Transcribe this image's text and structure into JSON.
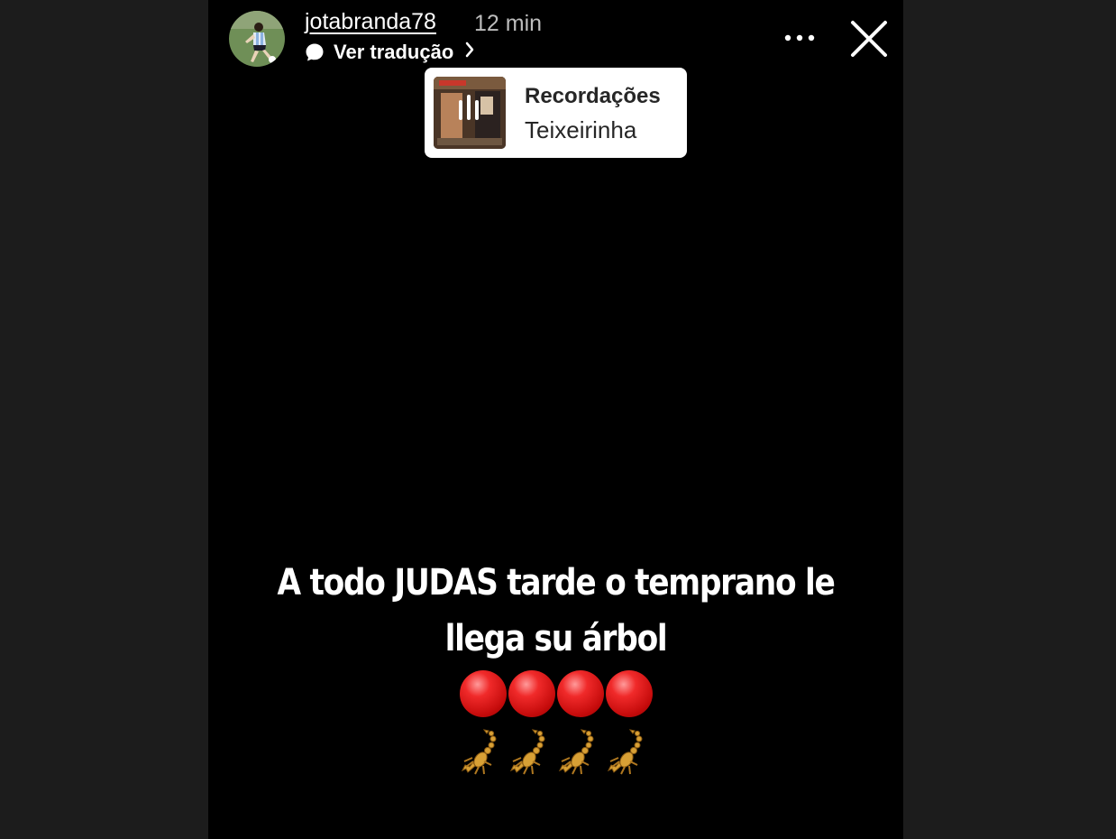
{
  "header": {
    "username": "jotabranda78",
    "time": "12 min",
    "translate_label": "Ver tradução",
    "avatar_icon": "player-avatar",
    "more_icon": "more-options-icon",
    "close_icon": "close-icon"
  },
  "music_sticker": {
    "title": "Recordações",
    "artist": "Teixeirinha",
    "cover_icon": "album-cover-with-equalizer-icon"
  },
  "caption": {
    "line1": "A  todo JUDAS tarde o temprano le",
    "line2": "llega su árbol"
  },
  "emoji_rows": {
    "circles": [
      "red-circle",
      "red-circle",
      "red-circle",
      "red-circle"
    ],
    "scorpions": [
      "scorpion",
      "scorpion",
      "scorpion",
      "scorpion"
    ]
  },
  "colors": {
    "story_bg": "#000000",
    "page_bg": "#1c1c1c",
    "red": "#e21b1b",
    "scorpion": "#d49a2a"
  }
}
